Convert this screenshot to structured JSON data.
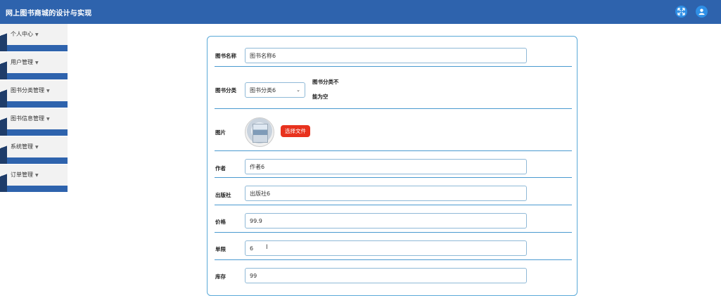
{
  "header": {
    "title": "网上图书商城的设计与实现",
    "icons": [
      "expand-icon",
      "user-icon"
    ]
  },
  "sidebar": {
    "items": [
      {
        "label": "个人中心"
      },
      {
        "label": "用户管理"
      },
      {
        "label": "图书分类管理"
      },
      {
        "label": "图书信息管理"
      },
      {
        "label": "系统管理"
      },
      {
        "label": "订单管理"
      }
    ]
  },
  "form": {
    "book_name": {
      "label": "图书名称",
      "value": "图书名称6"
    },
    "category": {
      "label": "图书分类",
      "value": "图书分类6",
      "warning_line1": "图书分类不",
      "warning_line2": "能为空"
    },
    "image": {
      "label": "图片",
      "button": "选择文件"
    },
    "author": {
      "label": "作者",
      "value": "作者6"
    },
    "publisher": {
      "label": "出版社",
      "value": "出版社6"
    },
    "price": {
      "label": "价格",
      "value": "99.9"
    },
    "limit": {
      "label": "单限",
      "value": "6"
    },
    "stock": {
      "label": "库存",
      "value": "99"
    }
  },
  "colors": {
    "header": "#2e63ad",
    "accent_button": "#e8321e",
    "row_line": "#4a9ad0"
  }
}
